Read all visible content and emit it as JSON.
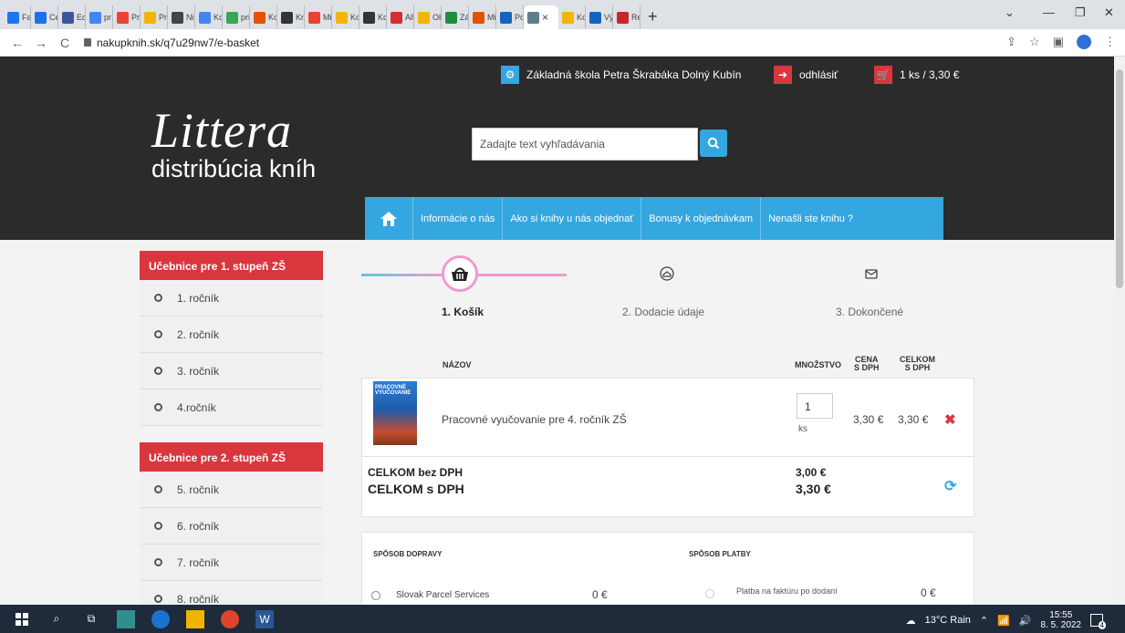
{
  "browser": {
    "tabs": [
      {
        "label": "Fac",
        "color": "#1877f2"
      },
      {
        "label": "Ce",
        "color": "#1a73e8"
      },
      {
        "label": "Ed",
        "color": "#3b5998"
      },
      {
        "label": "pr",
        "color": "#4285f4"
      },
      {
        "label": "Pri",
        "color": "#ea4335"
      },
      {
        "label": "Pri",
        "color": "#f4b400"
      },
      {
        "label": "Ni",
        "color": "#444444"
      },
      {
        "label": "Ko",
        "color": "#4285f4"
      },
      {
        "label": "pri",
        "color": "#34a853"
      },
      {
        "label": "Ko",
        "color": "#e65100"
      },
      {
        "label": "Kn",
        "color": "#333333"
      },
      {
        "label": "Mi",
        "color": "#ea4335"
      },
      {
        "label": "Ko",
        "color": "#f4b400"
      },
      {
        "label": "Ko",
        "color": "#333333"
      },
      {
        "label": "All",
        "color": "#d32f2f"
      },
      {
        "label": "Ob",
        "color": "#f4b400"
      },
      {
        "label": "Zá",
        "color": "#1e8e3e"
      },
      {
        "label": "Mi",
        "color": "#e65100"
      },
      {
        "label": "Po",
        "color": "#1565c0"
      },
      {
        "label": "Ko",
        "color": "#f4b400"
      },
      {
        "label": "Vý",
        "color": "#1565c0"
      },
      {
        "label": "Re",
        "color": "#c62828"
      }
    ],
    "active_tab_close": "×",
    "new_tab": "+",
    "url": "nakupknih.sk/q7u29nw7/e-basket"
  },
  "site": {
    "logo_main": "Littera",
    "logo_sub": "distribúcia kníh",
    "school": "Základná škola Petra Škrabáka Dolný Kubín",
    "logout": "odhlásiť",
    "cart_summary": "1 ks / 3,30 €",
    "search_placeholder": "Zadajte text vyhľadávania",
    "nav": [
      "Informácie o nás",
      "Ako si knihy u nás objednať",
      "Bonusy k objednávkam",
      "Nenašli ste knihu ?"
    ],
    "accent": "#35a7e0",
    "red": "#d9363e"
  },
  "sidebar": {
    "group1_title": "Učebnice pre 1. stupeň ZŠ",
    "group1_items": [
      "1. ročník",
      "2. ročník",
      "3. ročník",
      "4.ročník"
    ],
    "group2_title": "Učebnice pre 2. stupeň ZŠ",
    "group2_items": [
      "5. ročník",
      "6. ročník",
      "7. ročník",
      "8. ročník"
    ]
  },
  "steps": {
    "step1": "1. Košík",
    "step2": "2. Dodacie údaje",
    "step3": "3. Dokončené"
  },
  "cart": {
    "col_name": "NÁZOV",
    "col_qty": "MNOŽSTVO",
    "col_price_1": "CENA",
    "col_price_2": "S DPH",
    "col_total_1": "CELKOM",
    "col_total_2": "S DPH",
    "item": {
      "thumb_text": "PRACOVNÉ VYUČOVANIE",
      "title": "Pracovné vyučovanie pre 4. ročník ZŠ",
      "qty": "1",
      "unit": "ks",
      "price": "3,30 €",
      "total": "3,30 €"
    },
    "total_without_vat_label": "CELKOM bez DPH",
    "total_without_vat": "3,00 €",
    "total_with_vat_label": "CELKOM s DPH",
    "total_with_vat": "3,30 €"
  },
  "shipping": {
    "delivery_title": "SPÔSOB DOPRAVY",
    "payment_title": "SPÔSOB PLATBY",
    "delivery_option": "Slovak Parcel Services",
    "delivery_price": "0 €",
    "payment_option": "Platba na faktúru po dodaní",
    "payment_price": "0 €"
  },
  "taskbar": {
    "weather": "13°C Rain",
    "time": "15:55",
    "date": "8. 5. 2022",
    "notif_count": "4"
  }
}
